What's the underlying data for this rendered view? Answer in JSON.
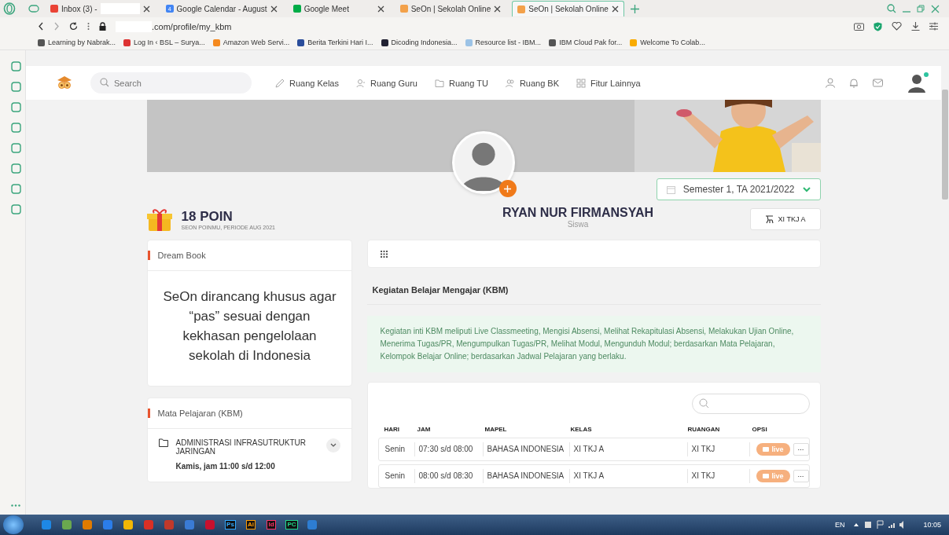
{
  "browser": {
    "tabs": [
      {
        "title": "Inbox (3) -",
        "selected": false,
        "redacted": true
      },
      {
        "title": "Google Calendar - August",
        "selected": false,
        "redacted": false
      },
      {
        "title": "Google Meet",
        "selected": false,
        "redacted": false
      },
      {
        "title": "SeOn | Sekolah Online",
        "selected": false,
        "redacted": false
      },
      {
        "title": "SeOn | Sekolah Online",
        "selected": true,
        "redacted": false
      }
    ],
    "calendar_badge": "4",
    "url": ".com/profile/my_kbm",
    "bookmarks": [
      "Learning by Nabrak...",
      "Log In ‹ BSL – Surya...",
      "Amazon Web Servi...",
      "Berita Terkini Hari I...",
      "Dicoding Indonesia...",
      "Resource list - IBM...",
      "IBM Cloud Pak for...",
      "Welcome To Colab..."
    ]
  },
  "header": {
    "search_placeholder": "Search",
    "nav": [
      "Ruang Kelas",
      "Ruang Guru",
      "Ruang TU",
      "Ruang BK",
      "Fitur Lainnya"
    ],
    "online": true
  },
  "profile": {
    "points": "18 POIN",
    "points_caption": "SEON POINMU, PERIODE  AUG 2021",
    "name": "RYAN NUR FIRMANSYAH",
    "role": "Siswa",
    "semester": "Semester 1, TA 2021/2022",
    "class": "XI TKJ A"
  },
  "dream_book": {
    "title": "Dream Book",
    "text": "SeOn dirancang khusus agar “pas” sesuai dengan kekhasan pengelolaan sekolah di Indonesia"
  },
  "mata_pelajaran": {
    "title": "Mata Pelajaran  (KBM)",
    "subjects": [
      {
        "name": "ADMINISTRASI INFRASUTRUKTUR JARINGAN",
        "expanded": false,
        "schedule": "Kamis, jam 11:00 s/d 12:00"
      }
    ]
  },
  "kbm": {
    "title": "Kegiatan Belajar Mengajar (KBM)",
    "description": "Kegiatan inti KBM meliputi Live Classmeeting, Mengisi Absensi, Melihat Rekapitulasi Absensi, Melakukan Ujian Online, Menerima Tugas/PR, Mengumpulkan Tugas/PR, Melihat Modul, Mengunduh Modul; berdasarkan Mata Pelajaran, Kelompok Belajar Online; berdasarkan Jadwal Pelajaran yang berlaku."
  },
  "table": {
    "columns": [
      "HARI",
      "JAM",
      "MAPEL",
      "KELAS",
      "RUANGAN",
      "OPSI"
    ],
    "rows": [
      {
        "cells": [
          "Senin",
          "07:30 s/d 08:00",
          "BAHASA INDONESIA",
          "XI TKJ A",
          "XI TKJ"
        ],
        "action": "live",
        "more": "···"
      },
      {
        "cells": [
          "Senin",
          "08:00 s/d 08:30",
          "BAHASA INDONESIA",
          "XI TKJ A",
          "XI TKJ"
        ],
        "action": "live",
        "more": "···"
      }
    ]
  },
  "taskbar": {
    "app_labels": [
      "Ps",
      "Ai",
      "Id",
      "PC"
    ],
    "language": "EN",
    "time": "10:05"
  }
}
